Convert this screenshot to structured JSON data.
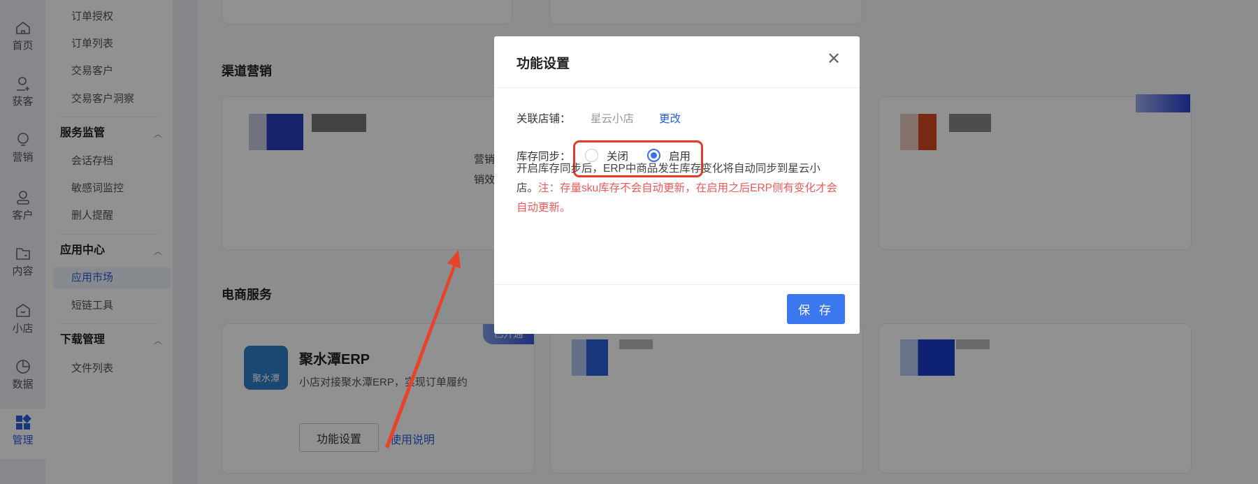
{
  "rail": [
    {
      "label": "首页",
      "icon": "home-icon"
    },
    {
      "label": "获客",
      "icon": "user-add-icon"
    },
    {
      "label": "营销",
      "icon": "bulb-icon"
    },
    {
      "label": "客户",
      "icon": "user-icon"
    },
    {
      "label": "内容",
      "icon": "folder-icon"
    },
    {
      "label": "小店",
      "icon": "shop-icon"
    },
    {
      "label": "数据",
      "icon": "pie-chart-icon"
    },
    {
      "label": "管理",
      "icon": "apps-icon",
      "active": true
    }
  ],
  "submenu": {
    "items_top": [
      "订单授权",
      "订单列表",
      "交易客户",
      "交易客户洞察"
    ],
    "groups": [
      {
        "title": "服务监管",
        "items": [
          "会话存档",
          "敏感词监控",
          "删人提醒"
        ]
      },
      {
        "title": "应用中心",
        "items": [
          "应用市场",
          "短链工具"
        ],
        "active": "应用市场"
      },
      {
        "title": "下载管理",
        "items": [
          "文件列表"
        ]
      }
    ]
  },
  "main": {
    "section_channel": "渠道营销",
    "channel_card_text": [
      "营销触达",
      "销效果"
    ],
    "section_ecommerce": "电商服务",
    "erp_card": {
      "badge": "已开通",
      "logo_text": "聚水潭",
      "title": "聚水潭ERP",
      "desc": "小店对接聚水潭ERP，实现订单履约",
      "settings_button": "功能设置",
      "help_link": "使用说明"
    }
  },
  "modal": {
    "title": "功能设置",
    "store_label": "关联店铺：",
    "store_value": "星云小店",
    "change_link": "更改",
    "sync_label": "库存同步：",
    "options": [
      {
        "label": "关闭",
        "checked": false
      },
      {
        "label": "启用",
        "checked": true
      }
    ],
    "desc": "开启库存同步后，ERP中商品发生库存变化将自动同步到星云小店。",
    "warning": "注：存量sku库存不会自动更新，在启用之后ERP侧有变化才会自动更新。",
    "save_button": "保 存"
  },
  "colors": {
    "accent": "#3b78f0",
    "warning": "#ee5a5a",
    "annotation": "#e43a2a"
  }
}
